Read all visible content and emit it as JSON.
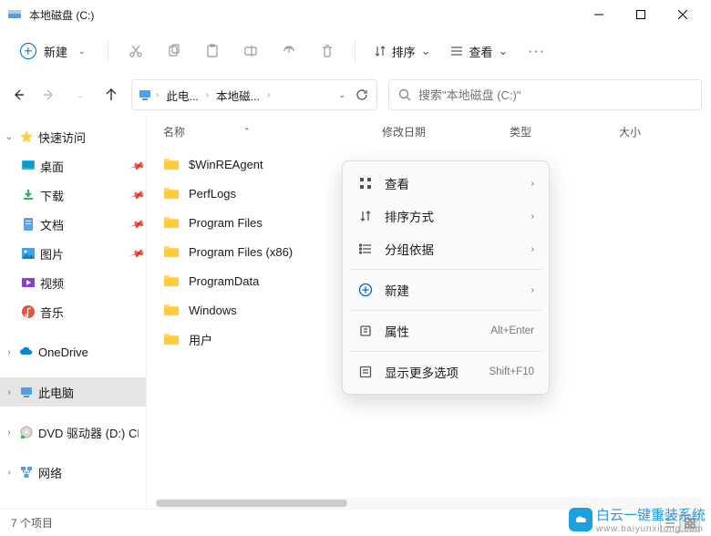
{
  "window": {
    "title": "本地磁盘 (C:)"
  },
  "toolbar": {
    "new_label": "新建",
    "sort_label": "排序",
    "view_label": "查看"
  },
  "breadcrumb": {
    "item1": "此电...",
    "item2": "本地磁..."
  },
  "search": {
    "placeholder": "搜索\"本地磁盘 (C:)\""
  },
  "columns": {
    "name": "名称",
    "date": "修改日期",
    "type": "类型",
    "size": "大小"
  },
  "sidebar": {
    "quick_access": "快速访问",
    "desktop": "桌面",
    "downloads": "下载",
    "documents": "文档",
    "pictures": "图片",
    "videos": "视频",
    "music": "音乐",
    "onedrive": "OneDrive",
    "this_pc": "此电脑",
    "dvd": "DVD 驱动器 (D:) CP",
    "network": "网络"
  },
  "files": [
    {
      "name": "$WinREAgent"
    },
    {
      "name": "PerfLogs"
    },
    {
      "name": "Program Files"
    },
    {
      "name": "Program Files (x86)"
    },
    {
      "name": "ProgramData"
    },
    {
      "name": "Windows"
    },
    {
      "name": "用户"
    }
  ],
  "context_menu": {
    "view": "查看",
    "sort": "排序方式",
    "group": "分组依据",
    "new": "新建",
    "properties": "属性",
    "properties_shortcut": "Alt+Enter",
    "more": "显示更多选项",
    "more_shortcut": "Shift+F10"
  },
  "statusbar": {
    "item_count": "7 个项目"
  },
  "watermark": {
    "text": "白云一键重装系统",
    "sub": "www.baiyunxitong.com"
  }
}
